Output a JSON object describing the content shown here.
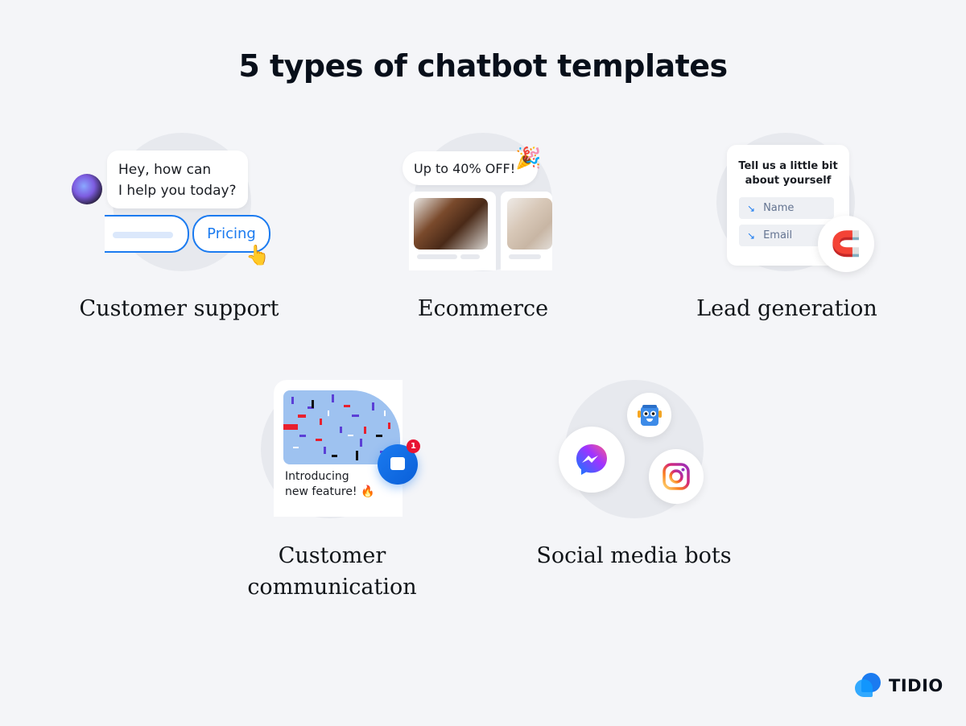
{
  "title": "5 types of chatbot templates",
  "templates": [
    {
      "label": "Customer support",
      "bot_message": [
        "Hey, how can",
        "I help you today?"
      ],
      "quick_reply": "Pricing",
      "icons": [
        "bot-avatar-icon",
        "hand-cursor-icon"
      ]
    },
    {
      "label": "Ecommerce",
      "promo": "Up to 40% OFF!",
      "icons": [
        "party-popper-icon"
      ],
      "products": [
        "brown-buckle-boot",
        "beige-heeled-boot"
      ]
    },
    {
      "label": "Lead generation",
      "form_title": [
        "Tell us a little bit",
        "about yourself"
      ],
      "fields": [
        "Name",
        "Email"
      ],
      "icons": [
        "magnet-icon"
      ]
    },
    {
      "label_lines": [
        "Customer",
        "communication"
      ],
      "announcement": [
        "Introducing",
        "new feature! 🔥"
      ],
      "notification_count": "1",
      "icons": [
        "chat-bubble-icon",
        "confetti-image"
      ]
    },
    {
      "label": "Social media bots",
      "icons": [
        "messenger-icon",
        "tidio-bot-icon",
        "instagram-icon"
      ]
    }
  ],
  "brand": {
    "name": "TIDIO",
    "accent": "#1b7bf0"
  }
}
